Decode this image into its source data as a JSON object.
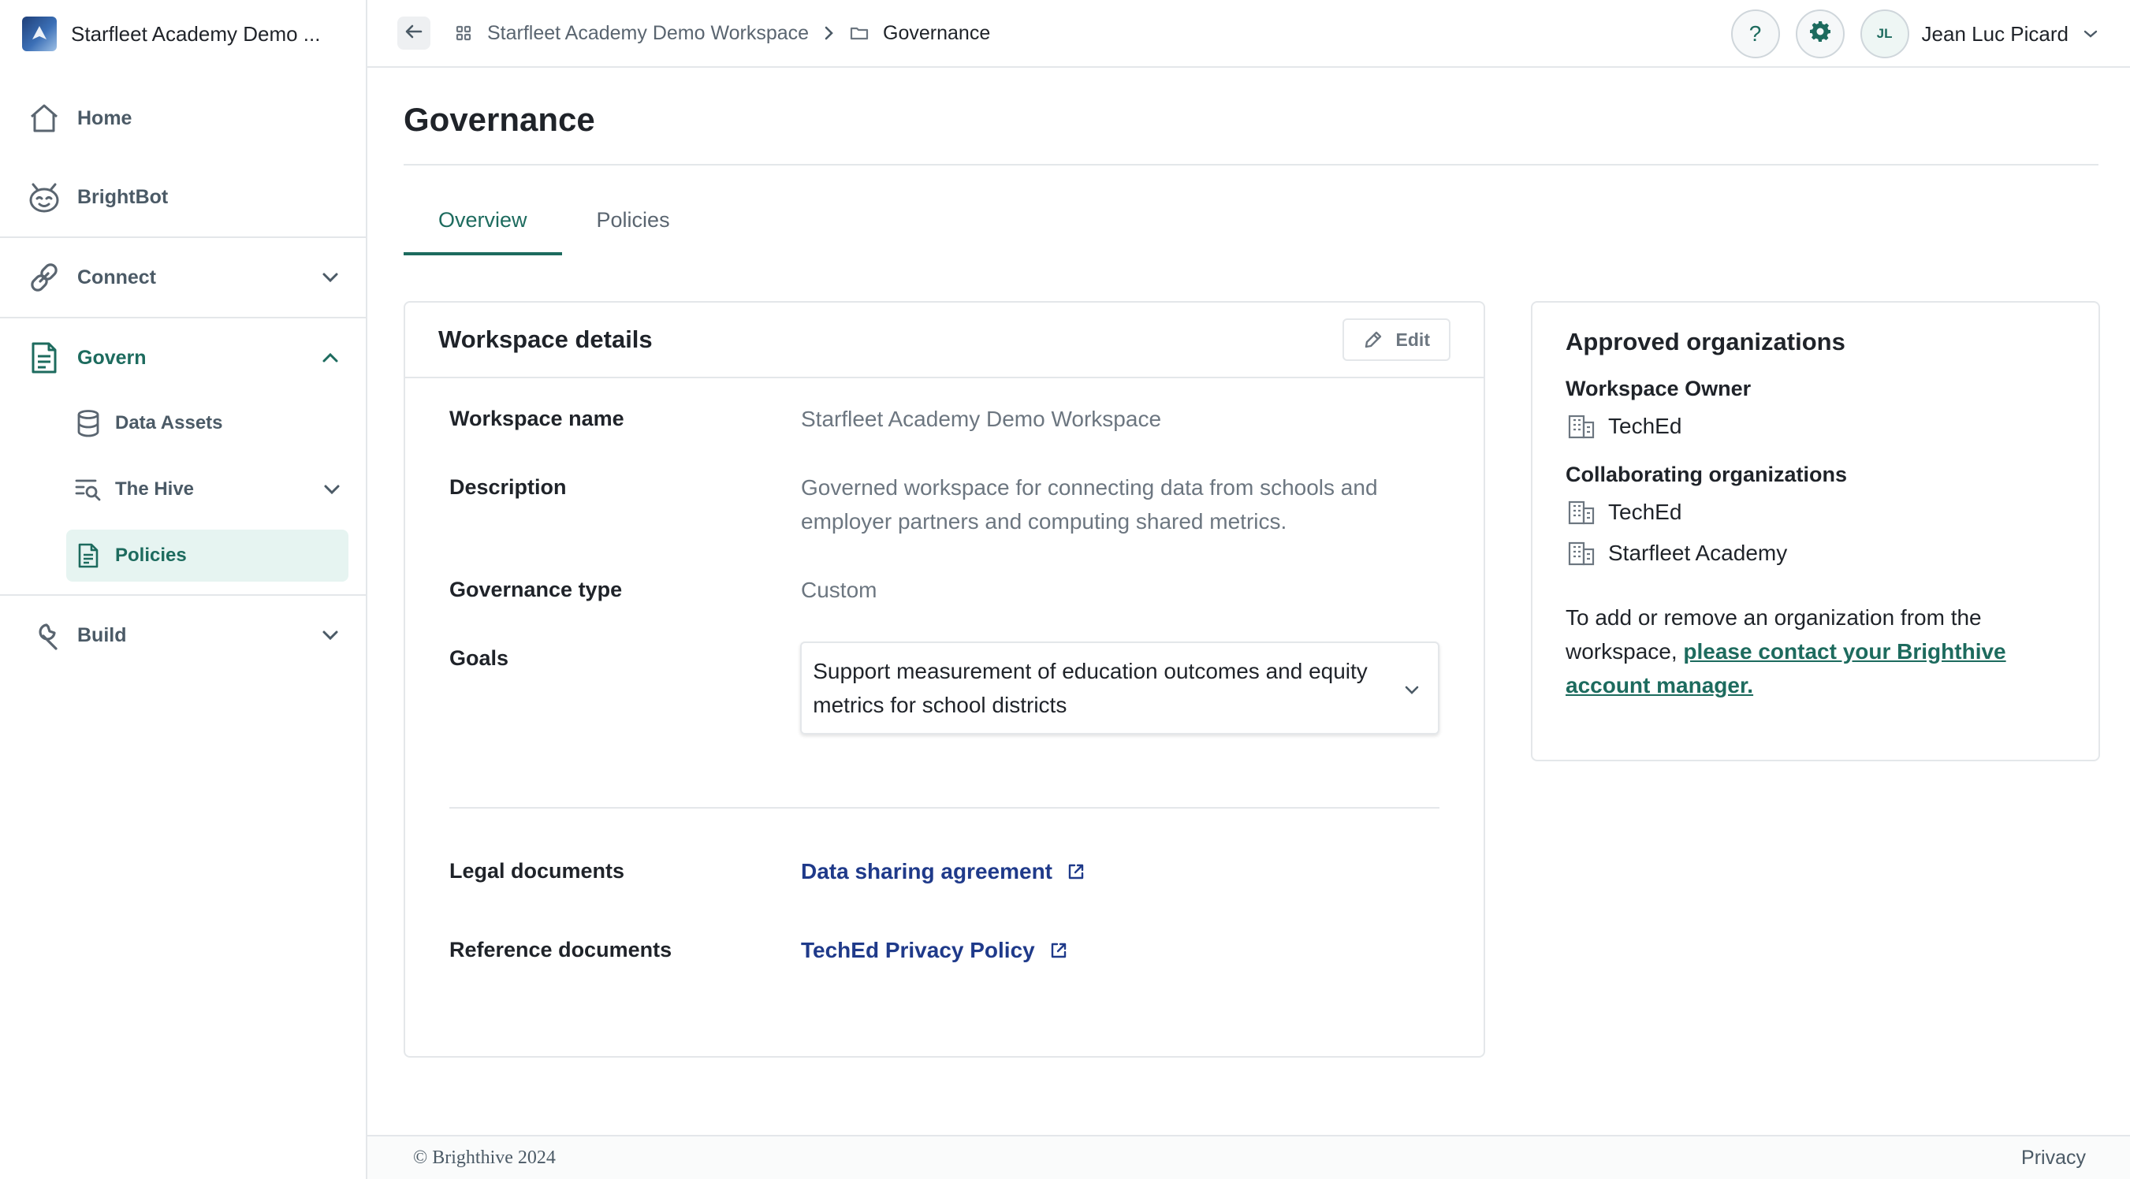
{
  "app": {
    "workspace_name": "Starfleet Academy Demo ..."
  },
  "sidebar": {
    "items": [
      {
        "label": "Home",
        "icon": "home-icon"
      },
      {
        "label": "BrightBot",
        "icon": "bot-icon"
      },
      {
        "label": "Connect",
        "icon": "link-icon",
        "expanded": false
      },
      {
        "label": "Govern",
        "icon": "document-icon",
        "expanded": true
      },
      {
        "label": "Build",
        "icon": "wrench-icon",
        "expanded": false
      }
    ],
    "govern_children": [
      {
        "label": "Data Assets",
        "icon": "database-icon"
      },
      {
        "label": "The Hive",
        "icon": "search-list-icon"
      },
      {
        "label": "Policies",
        "icon": "document-icon",
        "selected": true
      }
    ]
  },
  "topbar": {
    "breadcrumb": [
      {
        "label": "Starfleet Academy Demo Workspace",
        "icon": "grid-icon"
      },
      {
        "label": "Governance",
        "icon": "folder-icon"
      }
    ],
    "help_label": "?",
    "user_initials": "JL",
    "user_name": "Jean Luc Picard"
  },
  "page": {
    "title": "Governance",
    "tabs": [
      {
        "label": "Overview",
        "active": true
      },
      {
        "label": "Policies",
        "active": false
      }
    ]
  },
  "details": {
    "title": "Workspace details",
    "edit_label": "Edit",
    "fields": {
      "workspace_name_label": "Workspace name",
      "workspace_name_value": "Starfleet Academy Demo Workspace",
      "description_label": "Description",
      "description_value": "Governed workspace for connecting data from schools and employer partners and computing shared metrics.",
      "governance_type_label": "Governance type",
      "governance_type_value": "Custom",
      "goals_label": "Goals",
      "goals_value": "Support measurement of education outcomes and equity metrics for school districts",
      "legal_label": "Legal documents",
      "legal_link": "Data sharing agreement",
      "reference_label": "Reference documents",
      "reference_link": "TechEd Privacy Policy"
    }
  },
  "orgs": {
    "title": "Approved organizations",
    "owner_heading": "Workspace Owner",
    "owner": "TechEd",
    "collab_heading": "Collaborating organizations",
    "collaborators": [
      "TechEd",
      "Starfleet Academy"
    ],
    "note_text": "To add or remove an organization from the workspace, ",
    "note_link": "please contact your Brighthive account manager."
  },
  "footer": {
    "copyright": "© Brighthive 2024",
    "privacy": "Privacy"
  },
  "colors": {
    "accent": "#1d6b5e",
    "link": "#1f3a8a",
    "muted": "#6c7680",
    "border": "#e4e7ea"
  }
}
